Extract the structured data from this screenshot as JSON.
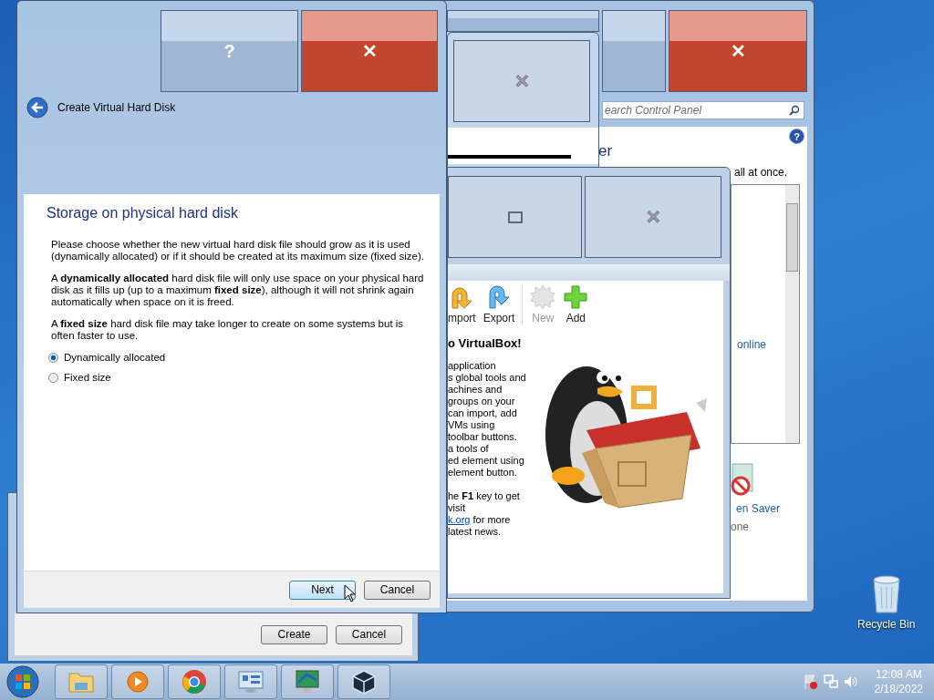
{
  "control_panel": {
    "title_buttons": [
      {
        "kind": "minimize"
      },
      {
        "kind": "maximize"
      },
      {
        "kind": "close",
        "label": "✕"
      }
    ],
    "search": {
      "placeholder": "earch Control Panel"
    },
    "help_label": "?",
    "heading": "er",
    "intro": "all at once.",
    "list_link": "online",
    "item_link": "en Saver",
    "item_note": "one"
  },
  "manager_small": {
    "title_buttons": [
      {
        "kind": "close",
        "label": "✕"
      }
    ]
  },
  "virtualbox": {
    "title_buttons": [
      {
        "kind": "restore"
      },
      {
        "kind": "close",
        "label": "✕"
      }
    ],
    "toolbar": [
      {
        "kind": "import",
        "label": "mport",
        "disabled": false
      },
      {
        "kind": "export",
        "label": "Export",
        "disabled": false
      },
      {
        "kind": "new",
        "label": "New",
        "disabled": true
      },
      {
        "kind": "add",
        "label": "Add",
        "disabled": false
      }
    ],
    "welcome_heading": "o VirtualBox!",
    "welcome_blocks": [
      [
        {
          "text": "application"
        },
        {
          "text": "s global tools and"
        },
        {
          "text": "achines and"
        },
        {
          "text": "groups on your"
        },
        {
          "text": "can import, add"
        },
        {
          "text": "VMs using"
        },
        {
          "text": "toolbar buttons."
        },
        {
          "text": "a tools of"
        },
        {
          "text": "ed element using"
        },
        {
          "text": "element button."
        }
      ],
      [
        {
          "text": "he **F1** key to get"
        },
        {
          "text": "visit"
        },
        {
          "link": "k.org",
          "text": " for more"
        },
        {
          "text": "latest news."
        }
      ]
    ]
  },
  "parent_dialog": {
    "buttons": [
      {
        "label": "Create"
      },
      {
        "label": "Cancel"
      }
    ]
  },
  "wizard": {
    "title": "Create Virtual Hard Disk",
    "title_buttons": [
      {
        "kind": "help",
        "label": "?"
      },
      {
        "kind": "close",
        "label": "✕"
      }
    ],
    "heading": "Storage on physical hard disk",
    "paragraphs": [
      "Please choose whether the new virtual hard disk file should grow as it is used (dynamically allocated) or if it should be created at its maximum size (fixed size).",
      "A **dynamically allocated** hard disk file will only use space on your physical hard disk as it fills up (up to a maximum **fixed size**), although it will not shrink again automatically when space on it is freed.",
      "A **fixed size** hard disk file may take longer to create on some systems but is often faster to use."
    ],
    "options": [
      {
        "label": "Dynamically allocated",
        "selected": true
      },
      {
        "label": "Fixed size",
        "selected": false
      }
    ],
    "buttons": [
      {
        "label": "Next",
        "hovered": true
      },
      {
        "label": "Cancel",
        "hovered": false
      }
    ]
  },
  "desktop": {
    "recycle_bin": "Recycle Bin"
  },
  "taskbar": {
    "apps": [
      {
        "kind": "folder"
      },
      {
        "kind": "media"
      },
      {
        "kind": "browser"
      },
      {
        "kind": "panel"
      },
      {
        "kind": "monitor"
      },
      {
        "kind": "cube"
      }
    ],
    "time": "12:08 AM",
    "date": "2/18/2022"
  }
}
